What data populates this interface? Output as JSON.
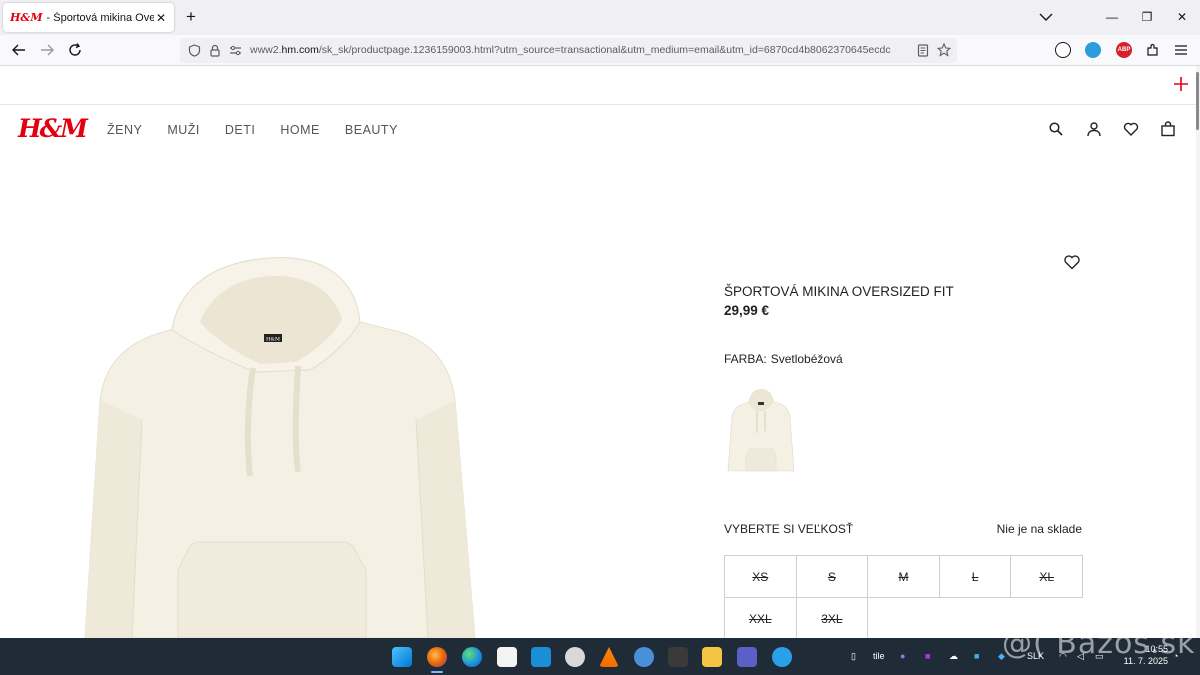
{
  "browser": {
    "tab_title": "- Športová mikina Oversized Fit",
    "tab_favicon": "H&M",
    "url_prefix": "www2.",
    "url_domain": "hm.com",
    "url_rest": "/sk_sk/productpage.1236159003.html?utm_source=transactional&utm_medium=email&utm_id=6870cd4b8062370645ecdc",
    "ext_abp": "ABP"
  },
  "header": {
    "logo": "H&M",
    "nav": [
      "ŽENY",
      "MUŽI",
      "DETI",
      "HOME",
      "BEAUTY"
    ]
  },
  "product": {
    "name": "ŠPORTOVÁ MIKINA OVERSIZED FIT",
    "price": "29,99 €",
    "color_label": "FARBA:",
    "color_value": "Svetlobéžová",
    "size_title": "VYBERTE SI VEĽKOSŤ",
    "stock_status": "Nie je na sklade",
    "sizes": [
      "XS",
      "S",
      "M",
      "L",
      "XL",
      "XXL",
      "3XL"
    ],
    "hoodie_tag": "H&M"
  },
  "taskbar": {
    "tray_label": "tile",
    "language": "SLK",
    "time": "10:55",
    "date": "11. 7. 2025",
    "watermark": "@( Bazos.sk"
  },
  "colors": {
    "brand_red": "#e50010",
    "hoodie": "#f5f0e4",
    "taskbar": "#1f2b36"
  }
}
